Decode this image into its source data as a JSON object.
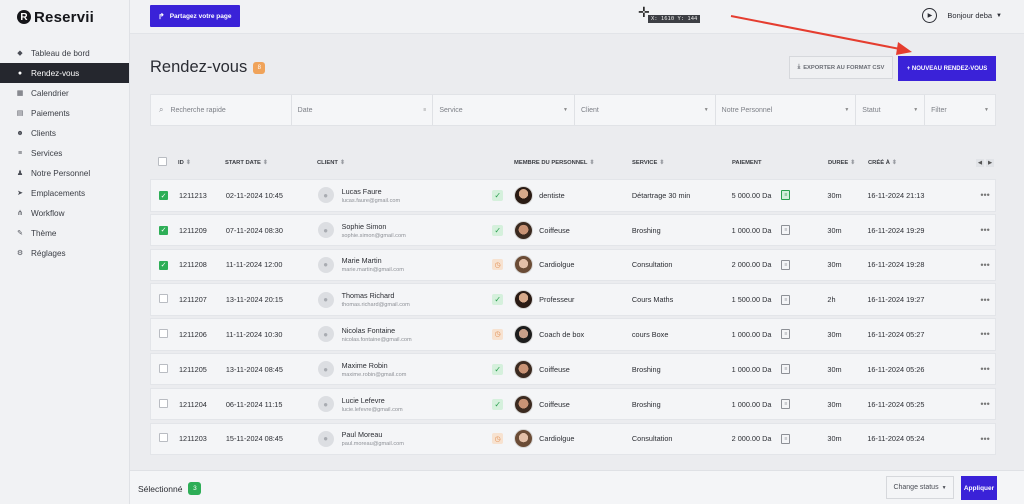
{
  "brand": {
    "name": "Reservii",
    "mark": "R"
  },
  "sidebar": {
    "items": [
      {
        "label": "Tableau de bord",
        "icon": "dashboard-icon",
        "glyph": "◆"
      },
      {
        "label": "Rendez-vous",
        "icon": "clock-icon",
        "glyph": "●",
        "active": true
      },
      {
        "label": "Calendrier",
        "icon": "calendar-icon",
        "glyph": "▦"
      },
      {
        "label": "Paiements",
        "icon": "payments-icon",
        "glyph": "▤"
      },
      {
        "label": "Clients",
        "icon": "clients-icon",
        "glyph": "☻"
      },
      {
        "label": "Services",
        "icon": "services-icon",
        "glyph": "≡"
      },
      {
        "label": "Notre Personnel",
        "icon": "staff-icon",
        "glyph": "♟"
      },
      {
        "label": "Emplacements",
        "icon": "location-icon",
        "glyph": "➤"
      },
      {
        "label": "Workflow",
        "icon": "workflow-icon",
        "glyph": "⋔"
      },
      {
        "label": "Thème",
        "icon": "brush-icon",
        "glyph": "✎"
      },
      {
        "label": "Réglages",
        "icon": "gear-icon",
        "glyph": "⚙"
      }
    ]
  },
  "topbar": {
    "share_label": "Partagez votre page",
    "cursor_readout": "X: 1610 Y: 144",
    "user_greeting": "Bonjour deba"
  },
  "page": {
    "title": "Rendez-vous",
    "count": "8",
    "export_label": "EXPORTER AU FORMAT CSV",
    "new_label": "+ NOUVEAU RENDEZ-VOUS"
  },
  "filters": {
    "search_placeholder": "Recherche rapide",
    "date": "Date",
    "service": "Service",
    "client": "Client",
    "staff": "Notre Personnel",
    "status": "Statut",
    "filter": "Filter"
  },
  "table": {
    "headers": {
      "id": "ID",
      "start": "START DATE",
      "client": "CLIENT",
      "staff": "MEMBRE DU PERSONNEL",
      "service": "SERVICE",
      "payment": "PAIEMENT",
      "duration": "DUREE",
      "created": "CRÉÉ À"
    },
    "rows": [
      {
        "checked": true,
        "id": "1211213",
        "start": "02-11-2024 10:45",
        "client": "Lucas Faure",
        "email": "lucas.faure@gmail.com",
        "status": "confirmed",
        "staff": "dentiste",
        "photo": "a",
        "service": "Détartrage 30 min",
        "payment": "5 000.00 Da",
        "paid": true,
        "duration": "30m",
        "created": "16-11-2024 21:13"
      },
      {
        "checked": true,
        "id": "1211209",
        "start": "07-11-2024 08:30",
        "client": "Sophie Simon",
        "email": "sophie.simon@gmail.com",
        "status": "confirmed",
        "staff": "Coiffeuse",
        "photo": "b",
        "service": "Broshing",
        "payment": "1 000.00 Da",
        "paid": false,
        "duration": "30m",
        "created": "16-11-2024 19:29"
      },
      {
        "checked": true,
        "id": "1211208",
        "start": "11-11-2024 12:00",
        "client": "Marie Martin",
        "email": "marie.martin@gmail.com",
        "status": "pending",
        "staff": "Cardiolgue",
        "photo": "c",
        "service": "Consultation",
        "payment": "2 000.00 Da",
        "paid": false,
        "duration": "30m",
        "created": "16-11-2024 19:28"
      },
      {
        "checked": false,
        "id": "1211207",
        "start": "13-11-2024 20:15",
        "client": "Thomas Richard",
        "email": "thomas.richard@gmail.com",
        "status": "confirmed",
        "staff": "Professeur",
        "photo": "a",
        "service": "Cours Maths",
        "payment": "1 500.00 Da",
        "paid": false,
        "duration": "2h",
        "created": "16-11-2024 19:27"
      },
      {
        "checked": false,
        "id": "1211206",
        "start": "11-11-2024 10:30",
        "client": "Nicolas Fontaine",
        "email": "nicolas.fontaine@gmail.com",
        "status": "pending",
        "staff": "Coach de box",
        "photo": "d",
        "service": "cours Boxe",
        "payment": "1 000.00 Da",
        "paid": false,
        "duration": "30m",
        "created": "16-11-2024 05:27"
      },
      {
        "checked": false,
        "id": "1211205",
        "start": "13-11-2024 08:45",
        "client": "Maxime Robin",
        "email": "maxime.robin@gmail.com",
        "status": "confirmed",
        "staff": "Coiffeuse",
        "photo": "b",
        "service": "Broshing",
        "payment": "1 000.00 Da",
        "paid": false,
        "duration": "30m",
        "created": "16-11-2024 05:26"
      },
      {
        "checked": false,
        "id": "1211204",
        "start": "06-11-2024 11:15",
        "client": "Lucie Lefevre",
        "email": "lucie.lefevre@gmail.com",
        "status": "confirmed",
        "staff": "Coiffeuse",
        "photo": "b",
        "service": "Broshing",
        "payment": "1 000.00 Da",
        "paid": false,
        "duration": "30m",
        "created": "16-11-2024 05:25"
      },
      {
        "checked": false,
        "id": "1211203",
        "start": "15-11-2024 08:45",
        "client": "Paul Moreau",
        "email": "paul.moreau@gmail.com",
        "status": "pending",
        "staff": "Cardiolgue",
        "photo": "c",
        "service": "Consultation",
        "payment": "2 000.00 Da",
        "paid": false,
        "duration": "30m",
        "created": "16-11-2024 05:24"
      }
    ]
  },
  "bottombar": {
    "selected_label": "Sélectionné",
    "selected_count": "3",
    "status_select": "Change status",
    "apply_label": "Appliquer"
  },
  "colors": {
    "accent": "#3a22d8",
    "success": "#2eae57",
    "warning": "#e08c4e",
    "annotation": "#e53d2f"
  }
}
